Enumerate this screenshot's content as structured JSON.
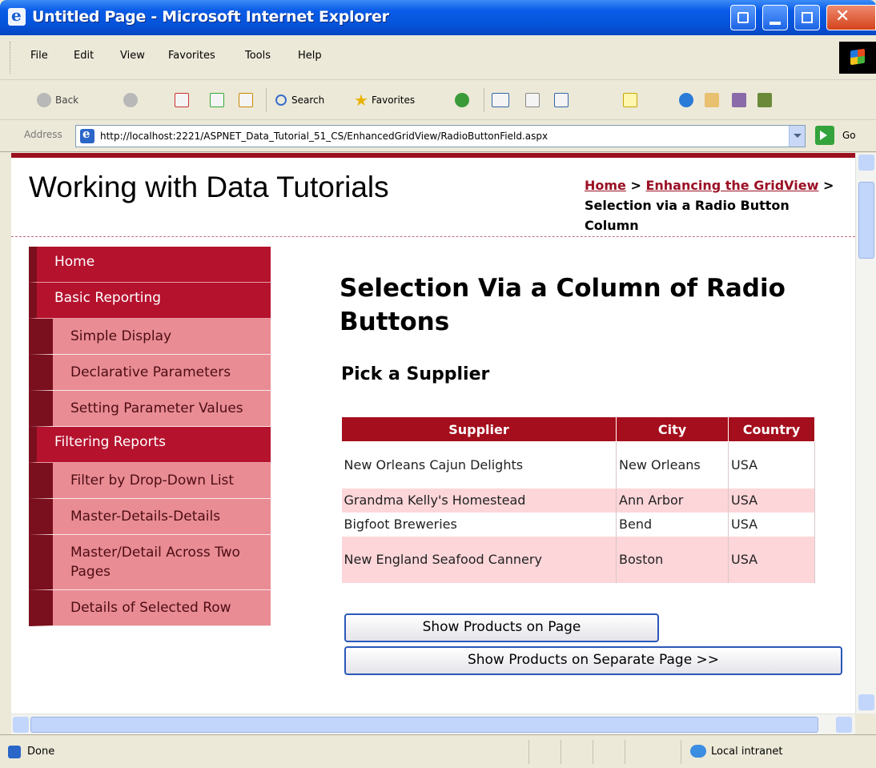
{
  "window": {
    "title": "Untitled Page - Microsoft Internet Explorer"
  },
  "menu": [
    "File",
    "Edit",
    "View",
    "Favorites",
    "Tools",
    "Help"
  ],
  "toolbar": {
    "back_label": "Back",
    "search_label": "Search",
    "favorites_label": "Favorites"
  },
  "address": {
    "label": "Address",
    "url": "http://localhost:2221/ASPNET_Data_Tutorial_51_CS/EnhancedGridView/RadioButtonField.aspx",
    "go_label": "Go"
  },
  "site": {
    "title": "Working with Data Tutorials"
  },
  "breadcrumb": {
    "home": "Home",
    "sep1": " > ",
    "parent": "Enhancing the GridView",
    "sep2": " > ",
    "current": "Selection via a Radio Button Column"
  },
  "sidebar": {
    "items": [
      {
        "label": "Home",
        "level": "head"
      },
      {
        "label": "Basic Reporting",
        "level": "head"
      },
      {
        "label": "Simple Display",
        "level": "sub"
      },
      {
        "label": "Declarative Parameters",
        "level": "sub"
      },
      {
        "label": "Setting Parameter Values",
        "level": "sub"
      },
      {
        "label": "Filtering Reports",
        "level": "head"
      },
      {
        "label": "Filter by Drop-Down List",
        "level": "sub"
      },
      {
        "label": "Master-Details-Details",
        "level": "sub"
      },
      {
        "label": "Master/Detail Across Two Pages",
        "level": "sub"
      },
      {
        "label": "Details of Selected Row",
        "level": "sub"
      }
    ]
  },
  "main": {
    "title": "Selection Via a Column of Radio Buttons",
    "subheading": "Pick a Supplier",
    "grid": {
      "headers": [
        "Supplier",
        "City",
        "Country"
      ],
      "rows": [
        [
          "New Orleans Cajun Delights",
          "New Orleans",
          "USA"
        ],
        [
          "Grandma Kelly's Homestead",
          "Ann Arbor",
          "USA"
        ],
        [
          "Bigfoot Breweries",
          "Bend",
          "USA"
        ],
        [
          "New England Seafood Cannery",
          "Boston",
          "USA"
        ]
      ]
    },
    "button_show_on_page": "Show Products on Page",
    "button_show_separate": "Show Products on Separate Page >>"
  },
  "status": {
    "text": "Done",
    "zone": "Local intranet"
  }
}
